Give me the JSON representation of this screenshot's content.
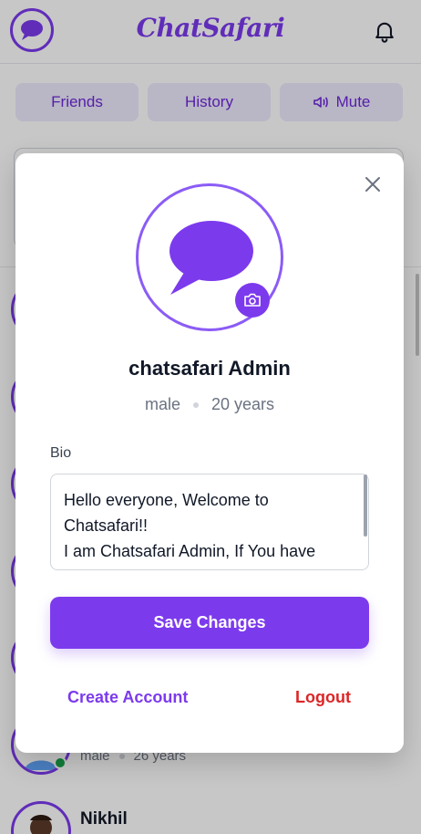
{
  "header": {
    "title": "ChatSafari"
  },
  "tabs": [
    {
      "label": "Friends"
    },
    {
      "label": "History"
    },
    {
      "label": "Mute"
    }
  ],
  "background_list": {
    "partial_meta": {
      "gender": "male",
      "age": "26 years"
    },
    "partial_name": "Nikhil"
  },
  "modal": {
    "name": "chatsafari Admin",
    "gender": "male",
    "age": "20 years",
    "bio_label": "Bio",
    "bio_text": "Hello everyone, Welcome to Chatsafari!!\nI am Chatsafari Admin, If You have",
    "save_label": "Save Changes",
    "create_account_label": "Create Account",
    "logout_label": "Logout"
  },
  "colors": {
    "accent": "#7c3aed",
    "danger": "#dc2626",
    "online": "#16a34a"
  }
}
